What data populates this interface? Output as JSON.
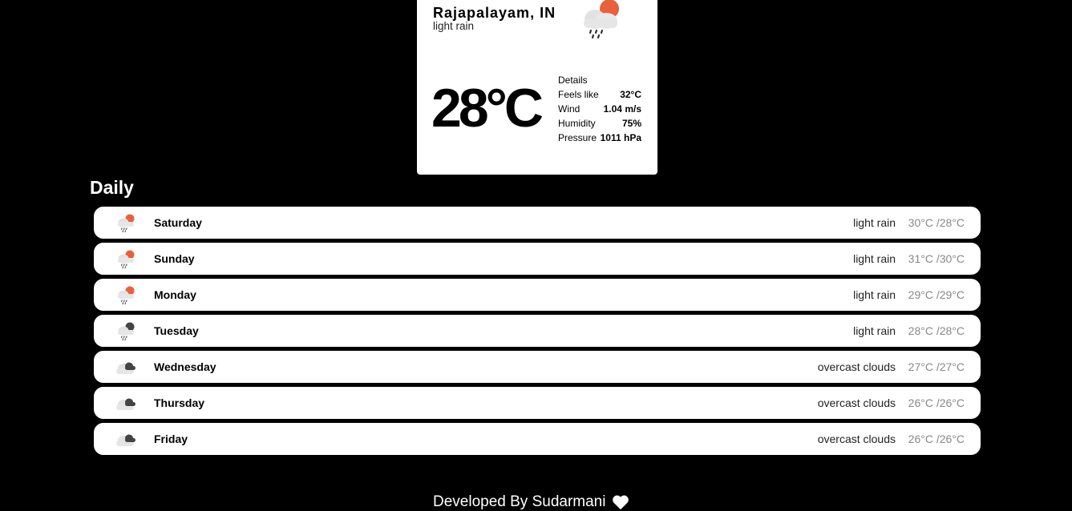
{
  "current": {
    "city": "Rajapalayam, IN",
    "description": "light rain",
    "temperature": "28°C",
    "icon": "light-rain-sun-icon",
    "details": {
      "heading": "Details",
      "rows": [
        {
          "label": "Feels like",
          "value": "32°C"
        },
        {
          "label": "Wind",
          "value": "1.04 m/s"
        },
        {
          "label": "Humidity",
          "value": "75%"
        },
        {
          "label": "Pressure",
          "value": "1011 hPa"
        }
      ]
    }
  },
  "daily": {
    "title": "Daily",
    "days": [
      {
        "day": "Saturday",
        "description": "light rain",
        "temps": "30°C /28°C",
        "icon": "rain-day-icon"
      },
      {
        "day": "Sunday",
        "description": "light rain",
        "temps": "31°C /30°C",
        "icon": "rain-day-icon"
      },
      {
        "day": "Monday",
        "description": "light rain",
        "temps": "29°C /29°C",
        "icon": "rain-day-icon"
      },
      {
        "day": "Tuesday",
        "description": "light rain",
        "temps": "28°C /28°C",
        "icon": "rain-night-icon"
      },
      {
        "day": "Wednesday",
        "description": "overcast clouds",
        "temps": "27°C /27°C",
        "icon": "overcast-clouds-icon"
      },
      {
        "day": "Thursday",
        "description": "overcast clouds",
        "temps": "26°C /26°C",
        "icon": "overcast-clouds-icon"
      },
      {
        "day": "Friday",
        "description": "overcast clouds",
        "temps": "26°C /26°C",
        "icon": "overcast-clouds-icon"
      }
    ]
  },
  "footer": {
    "text": "Developed By Sudarmani",
    "icon": "heart-icon"
  },
  "colors": {
    "background": "#000000",
    "card": "#ffffff",
    "sun": "#e8603c",
    "cloud": "#e2e2e2",
    "dark_cloud": "#444444"
  }
}
